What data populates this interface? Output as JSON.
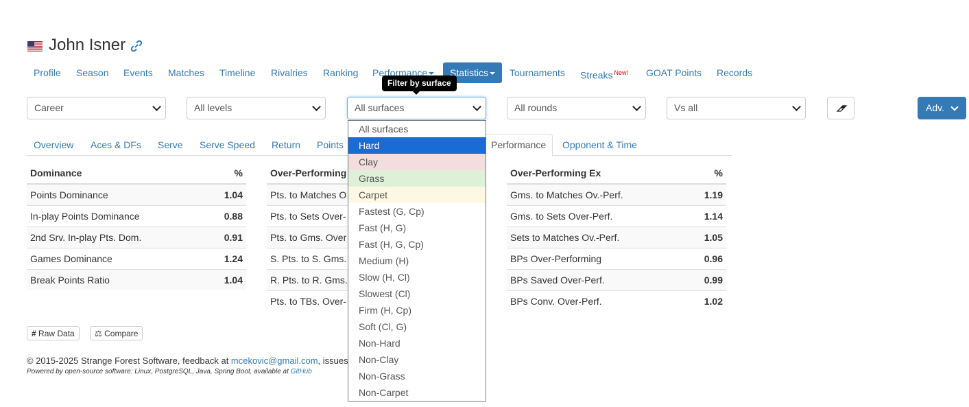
{
  "player": {
    "name": "John Isner"
  },
  "nav": {
    "items": [
      {
        "label": "Profile"
      },
      {
        "label": "Season"
      },
      {
        "label": "Events"
      },
      {
        "label": "Matches"
      },
      {
        "label": "Timeline"
      },
      {
        "label": "Rivalries"
      },
      {
        "label": "Ranking"
      },
      {
        "label": "Performance"
      },
      {
        "label": "Statistics"
      },
      {
        "label": "Tournaments"
      },
      {
        "label": "Streaks",
        "badge": "New!"
      },
      {
        "label": "GOAT Points"
      },
      {
        "label": "Records"
      }
    ],
    "active": "Statistics"
  },
  "filters": {
    "season": "Career",
    "level": "All levels",
    "surface": "All surfaces",
    "round": "All rounds",
    "opponent": "Vs all",
    "adv_label": "Adv."
  },
  "tooltip": "Filter by surface",
  "surface_options": [
    {
      "label": "All surfaces",
      "bg": ""
    },
    {
      "label": "Hard",
      "bg": "#1a6bd4"
    },
    {
      "label": "Clay",
      "bg": "#f2dede"
    },
    {
      "label": "Grass",
      "bg": "#dff0d8"
    },
    {
      "label": "Carpet",
      "bg": "#fcf8e3"
    },
    {
      "label": "Fastest (G, Cp)",
      "bg": ""
    },
    {
      "label": "Fast (H, G)",
      "bg": ""
    },
    {
      "label": "Fast (H, G, Cp)",
      "bg": ""
    },
    {
      "label": "Medium (H)",
      "bg": ""
    },
    {
      "label": "Slow (H, Cl)",
      "bg": ""
    },
    {
      "label": "Slowest (Cl)",
      "bg": ""
    },
    {
      "label": "Firm (H, Cp)",
      "bg": ""
    },
    {
      "label": "Soft (Cl, G)",
      "bg": ""
    },
    {
      "label": "Non-Hard",
      "bg": ""
    },
    {
      "label": "Non-Clay",
      "bg": ""
    },
    {
      "label": "Non-Grass",
      "bg": ""
    },
    {
      "label": "Non-Carpet",
      "bg": ""
    }
  ],
  "selected_surface": "Hard",
  "sub_tabs": [
    "Overview",
    "Aces & DFs",
    "Serve",
    "Serve Speed",
    "Return",
    "Points",
    "Performance",
    "Opponent & Time"
  ],
  "active_sub_tab": "Performance",
  "tables": {
    "dominance": {
      "header": "Dominance",
      "unit": "%",
      "rows": [
        {
          "label": "Points Dominance",
          "value": "1.04"
        },
        {
          "label": "In-play Points Dominance",
          "value": "0.88"
        },
        {
          "label": "2nd Srv. In-play Pts. Dom.",
          "value": "0.91"
        },
        {
          "label": "Games Dominance",
          "value": "1.24"
        },
        {
          "label": "Break Points Ratio",
          "value": "1.04"
        }
      ]
    },
    "over_performing": {
      "header": "Over-Performing",
      "rows": [
        {
          "label": "Pts. to Matches O"
        },
        {
          "label": "Pts. to Sets Over-"
        },
        {
          "label": "Pts. to Gms. Over"
        },
        {
          "label": "S. Pts. to S. Gms."
        },
        {
          "label": "R. Pts. to R. Gms."
        },
        {
          "label": "Pts. to TBs. Over-"
        }
      ]
    },
    "over_performing_ex": {
      "header": "Over-Performing Ex",
      "unit": "%",
      "rows": [
        {
          "label": "Gms. to Matches Ov.-Perf.",
          "value": "1.19"
        },
        {
          "label": "Gms. to Sets Over-Perf.",
          "value": "1.14"
        },
        {
          "label": "Sets to Matches Ov.-Perf.",
          "value": "1.05"
        },
        {
          "label": "BPs Over-Performing",
          "value": "0.96"
        },
        {
          "label": "BPs Saved Over-Perf.",
          "value": "0.99"
        },
        {
          "label": "BPs Conv. Over-Perf.",
          "value": "1.02"
        }
      ]
    }
  },
  "buttons": {
    "raw_data": "Raw Data",
    "compare": "Compare"
  },
  "footer": {
    "copyright": "© 2015-2025 Strange Forest Software, feedback at ",
    "email": "mcekovic@gmail.com",
    "issues": ", issues",
    "powered": "Powered by open-source software: Linux, PostgreSQL, Java, Spring Boot, available at ",
    "github": "GitHub"
  },
  "colors": {
    "accent": "#337ab7",
    "selected": "#1a6bd4"
  },
  "icons": [
    "flag-us-icon",
    "link-icon",
    "caret-down-icon",
    "eraser-icon",
    "chevron-down-icon",
    "hash-icon",
    "balance-scale-icon"
  ]
}
